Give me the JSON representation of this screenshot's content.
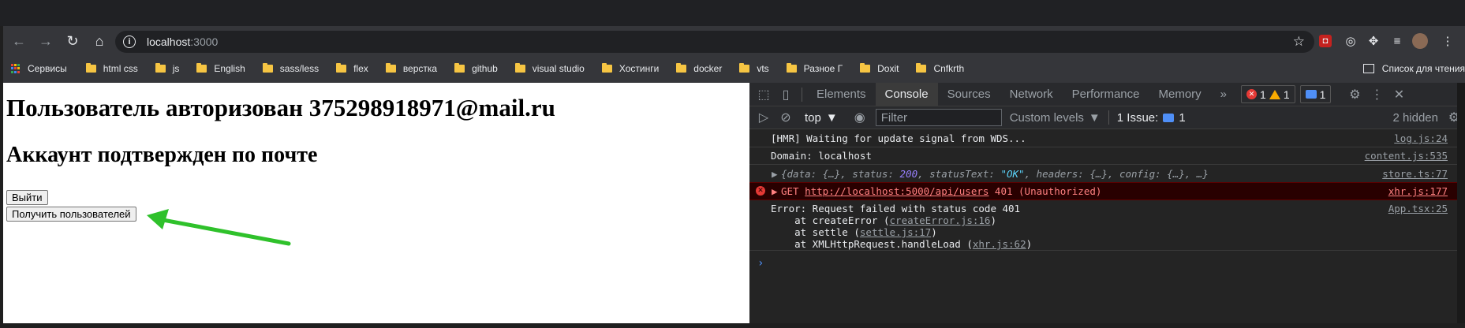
{
  "browser": {
    "url_host": "localhost",
    "url_port": ":3000",
    "bookmarks": [
      {
        "label": "Сервисы",
        "type": "apps"
      },
      {
        "label": "html css",
        "type": "folder"
      },
      {
        "label": "js",
        "type": "folder"
      },
      {
        "label": "English",
        "type": "folder"
      },
      {
        "label": "sass/less",
        "type": "folder"
      },
      {
        "label": "flex",
        "type": "folder"
      },
      {
        "label": "верстка",
        "type": "folder"
      },
      {
        "label": "github",
        "type": "folder"
      },
      {
        "label": "visual studio",
        "type": "folder"
      },
      {
        "label": "Хостинги",
        "type": "folder"
      },
      {
        "label": "docker",
        "type": "folder"
      },
      {
        "label": "vts",
        "type": "folder"
      },
      {
        "label": "Разное Г",
        "type": "folder"
      },
      {
        "label": "Doxit",
        "type": "folder"
      },
      {
        "label": "Cnfkrth",
        "type": "folder"
      }
    ],
    "reading_list": "Список для чтения"
  },
  "page": {
    "heading1": "Пользователь авторизован 375298918971@mail.ru",
    "heading2": "Аккаунт подтвержден по почте",
    "logout_button": "Выйти",
    "get_users_button": "Получить пользователей",
    "arrow_color": "#2fc12b"
  },
  "devtools": {
    "tabs": [
      "Elements",
      "Console",
      "Sources",
      "Network",
      "Performance",
      "Memory"
    ],
    "active_tab": "Console",
    "more_tabs": "»",
    "error_count": "1",
    "warning_count": "1",
    "message_count": "1",
    "context": "top",
    "filter_placeholder": "Filter",
    "levels": "Custom levels",
    "issues_label": "1 Issue:",
    "issues_count": "1",
    "hidden": "2 hidden",
    "console": {
      "line1": {
        "text": "[HMR] Waiting for update signal from WDS...",
        "src": "log.js:24"
      },
      "line2": {
        "text": "Domain: localhost",
        "src": "content.js:535"
      },
      "line3": {
        "parts": [
          "{data: {…}, status: ",
          "200",
          ", statusText: ",
          "\"OK\"",
          ", headers: {…}, config: {…}, …}"
        ],
        "src": "store.ts:77"
      },
      "line4": {
        "prefix": "GET ",
        "url": "http://localhost:5000/api/users",
        "suffix": " 401 (Unauthorized)",
        "src": "xhr.js:177"
      },
      "line5": {
        "text": "Error: Request failed with status code 401",
        "src": "App.tsx:25",
        "stack": [
          {
            "pre": "    at createError (",
            "link": "createError.js:16",
            "post": ")"
          },
          {
            "pre": "    at settle (",
            "link": "settle.js:17",
            "post": ")"
          },
          {
            "pre": "    at XMLHttpRequest.handleLoad (",
            "link": "xhr.js:62",
            "post": ")"
          }
        ]
      },
      "prompt": "›"
    }
  }
}
